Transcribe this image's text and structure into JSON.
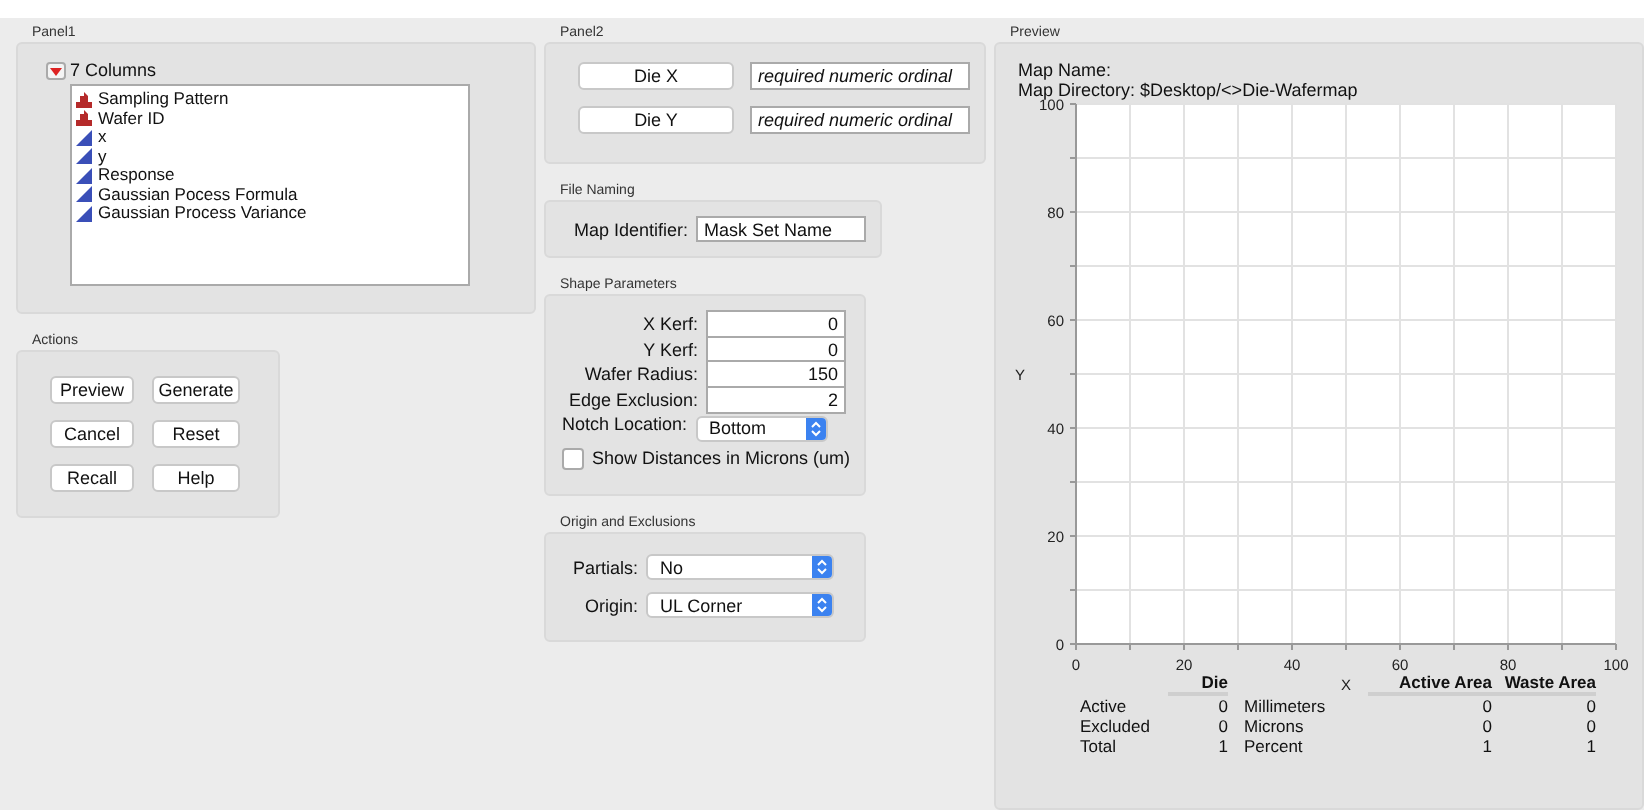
{
  "panel1": {
    "title": "Panel1",
    "column_count": "7 Columns",
    "expanded": true,
    "columns": [
      {
        "name": "Sampling Pattern",
        "kind": "nominal"
      },
      {
        "name": "Wafer ID",
        "kind": "nominal"
      },
      {
        "name": "x",
        "kind": "continuous"
      },
      {
        "name": "y",
        "kind": "continuous"
      },
      {
        "name": "Response",
        "kind": "continuous"
      },
      {
        "name": "Gaussian Pocess Formula",
        "kind": "continuous"
      },
      {
        "name": "Gaussian Process Variance",
        "kind": "continuous"
      }
    ]
  },
  "actions": {
    "title": "Actions",
    "buttons": [
      "Preview",
      "Generate",
      "Cancel",
      "Reset",
      "Recall",
      "Help"
    ]
  },
  "panel2": {
    "title": "Panel2",
    "roles": [
      {
        "button": "Die X",
        "placeholder": "required numeric ordinal"
      },
      {
        "button": "Die Y",
        "placeholder": "required numeric ordinal"
      }
    ]
  },
  "file_naming": {
    "title": "File Naming",
    "label": "Map Identifier:",
    "value": "Mask Set Name"
  },
  "shape_parameters": {
    "title": "Shape Parameters",
    "fields": [
      {
        "label": "X Kerf:",
        "value": "0"
      },
      {
        "label": "Y Kerf:",
        "value": "0"
      },
      {
        "label": "Wafer Radius:",
        "value": "150"
      },
      {
        "label": "Edge Exclusion:",
        "value": "2"
      }
    ],
    "notch_label": "Notch Location:",
    "notch_value": "Bottom",
    "microns_label": "Show Distances in Microns (um)",
    "microns_checked": false
  },
  "origin_exclusions": {
    "title": "Origin and Exclusions",
    "selects": [
      {
        "label": "Partials:",
        "value": "No"
      },
      {
        "label": "Origin:",
        "value": "UL Corner"
      }
    ]
  },
  "preview": {
    "title": "Preview",
    "map_name_label": "Map Name:",
    "map_directory_label": "Map Directory:",
    "map_directory": "$Desktop/<>Die-Wafermap",
    "chart_data": {
      "type": "scatter",
      "xlabel": "X",
      "ylabel": "Y",
      "xlim": [
        0,
        100
      ],
      "ylim": [
        0,
        100
      ],
      "xticks": [
        0,
        20,
        40,
        60,
        80,
        100
      ],
      "yticks": [
        0,
        20,
        40,
        60,
        80,
        100
      ],
      "grid": true
    },
    "die_table": {
      "header": "Die",
      "rows": [
        {
          "label": "Active",
          "value": "0"
        },
        {
          "label": "Excluded",
          "value": "0"
        },
        {
          "label": "Total",
          "value": "1"
        }
      ]
    },
    "area_table": {
      "headers": [
        "Active Area",
        "Waste Area"
      ],
      "rows": [
        {
          "label": "Millimeters",
          "values": [
            "0",
            "0"
          ]
        },
        {
          "label": "Microns",
          "values": [
            "0",
            "0"
          ]
        },
        {
          "label": "Percent",
          "values": [
            "1",
            "1"
          ]
        }
      ]
    }
  }
}
